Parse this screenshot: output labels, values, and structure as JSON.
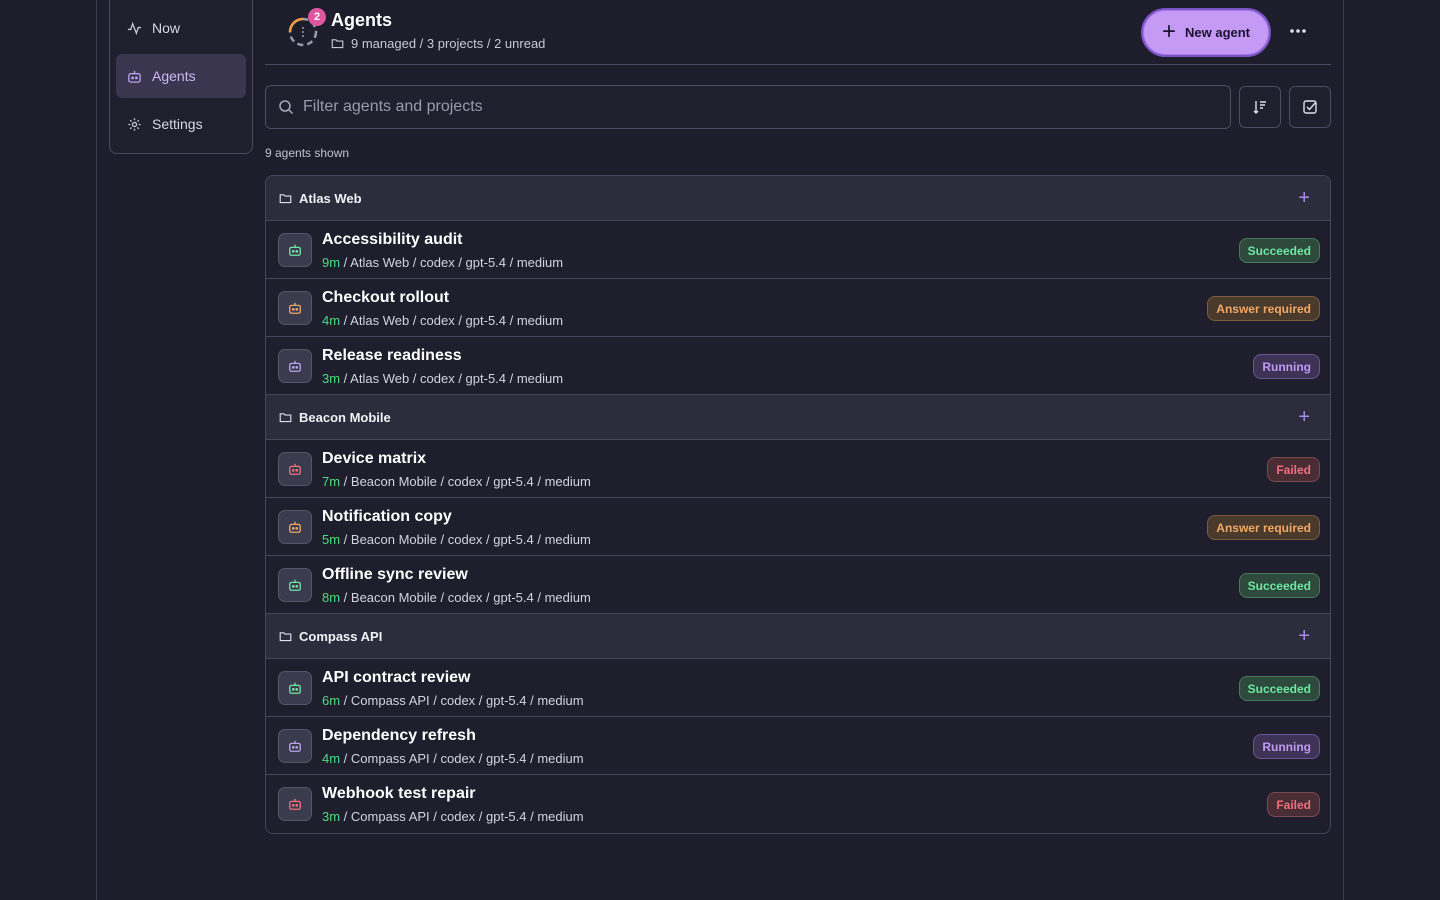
{
  "nav": {
    "items": [
      {
        "label": "Now",
        "icon": "activity-icon"
      },
      {
        "label": "Agents",
        "icon": "bot-icon",
        "active": true
      },
      {
        "label": "Settings",
        "icon": "gear-icon"
      }
    ]
  },
  "header": {
    "title": "Agents",
    "unread_count": "2",
    "subtitle": "9 managed / 3 projects / 2 unread",
    "new_agent_label": "New agent"
  },
  "filter": {
    "placeholder": "Filter agents and projects"
  },
  "list_count": "9 agents shown",
  "colors": {
    "accent": "#c49af5",
    "age_text": "#4ade80",
    "succeeded": "#6ee7a2",
    "answer_required": "#f0a868",
    "running": "#c09af0",
    "failed": "#f07080"
  },
  "groups": [
    {
      "name": "Atlas Web",
      "agents": [
        {
          "name": "Accessibility audit",
          "age": "9m",
          "meta": " / Atlas Web / codex / gpt-5.4 / medium",
          "status": "Succeeded",
          "status_class": "succeeded"
        },
        {
          "name": "Checkout rollout",
          "age": "4m",
          "meta": " / Atlas Web / codex / gpt-5.4 / medium",
          "status": "Answer required",
          "status_class": "answer"
        },
        {
          "name": "Release readiness",
          "age": "3m",
          "meta": " / Atlas Web / codex / gpt-5.4 / medium",
          "status": "Running",
          "status_class": "running"
        }
      ]
    },
    {
      "name": "Beacon Mobile",
      "agents": [
        {
          "name": "Device matrix",
          "age": "7m",
          "meta": " / Beacon Mobile / codex / gpt-5.4 / medium",
          "status": "Failed",
          "status_class": "failed"
        },
        {
          "name": "Notification copy",
          "age": "5m",
          "meta": " / Beacon Mobile / codex / gpt-5.4 / medium",
          "status": "Answer required",
          "status_class": "answer"
        },
        {
          "name": "Offline sync review",
          "age": "8m",
          "meta": " / Beacon Mobile / codex / gpt-5.4 / medium",
          "status": "Succeeded",
          "status_class": "succeeded"
        }
      ]
    },
    {
      "name": "Compass API",
      "agents": [
        {
          "name": "API contract review",
          "age": "6m",
          "meta": " / Compass API / codex / gpt-5.4 / medium",
          "status": "Succeeded",
          "status_class": "succeeded"
        },
        {
          "name": "Dependency refresh",
          "age": "4m",
          "meta": " / Compass API / codex / gpt-5.4 / medium",
          "status": "Running",
          "status_class": "running"
        },
        {
          "name": "Webhook test repair",
          "age": "3m",
          "meta": " / Compass API / codex / gpt-5.4 / medium",
          "status": "Failed",
          "status_class": "failed"
        }
      ]
    }
  ]
}
